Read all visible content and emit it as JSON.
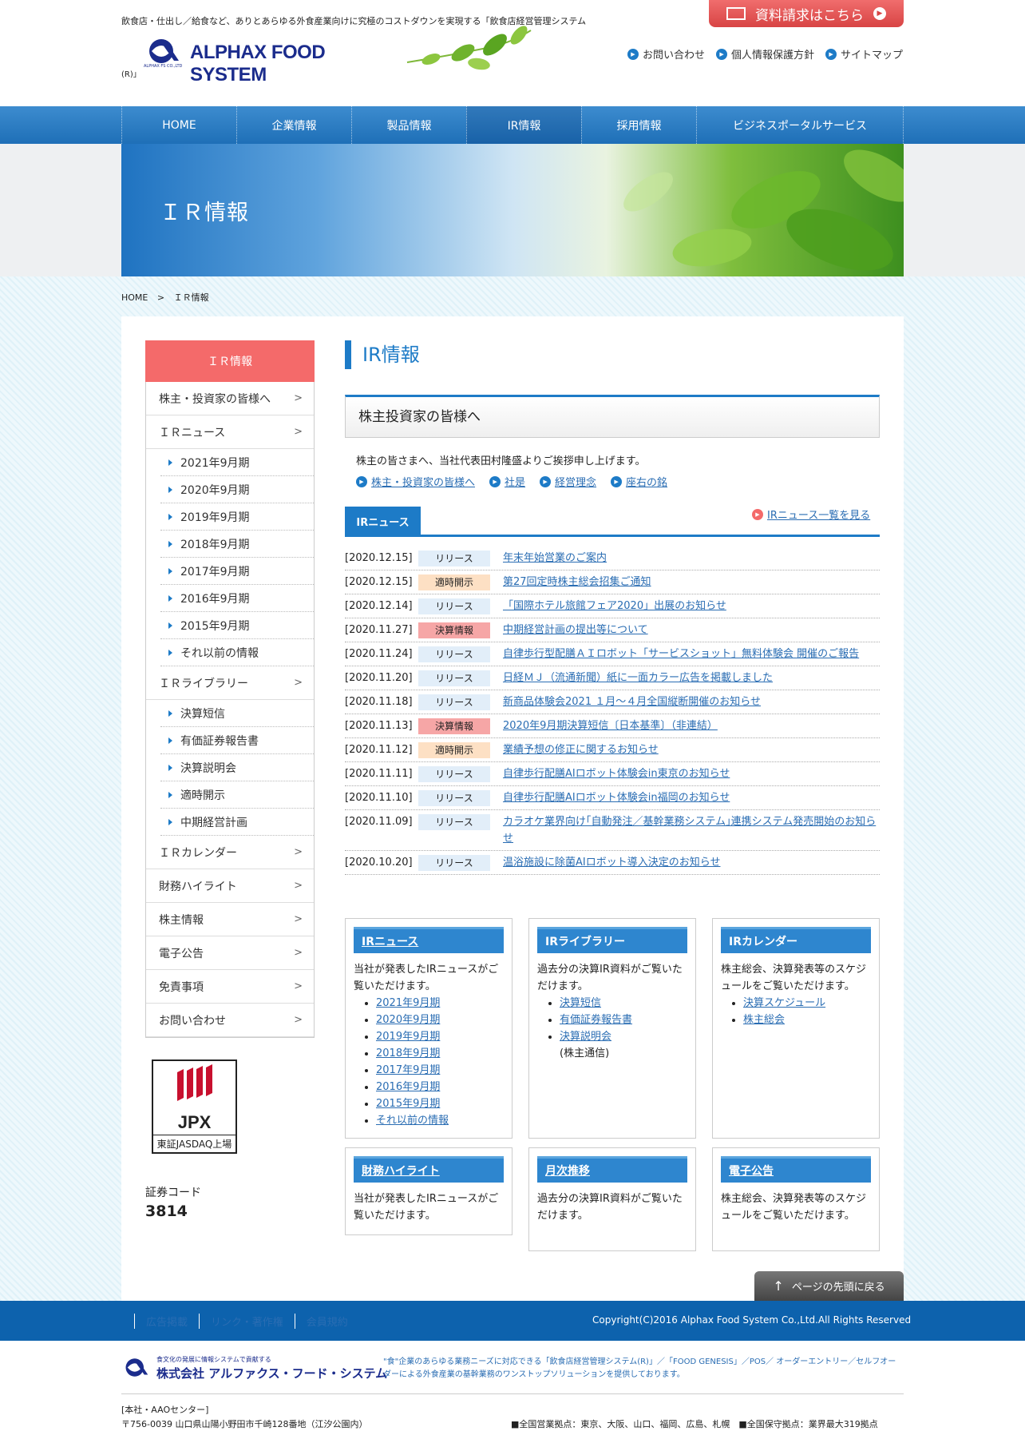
{
  "header": {
    "tagline": "飲食店・仕出し／給食など、ありとあらゆる外食産業向けに究極のコストダウンを実現する「飲食店経営管理システム",
    "tagline_end": "(R)」",
    "logo_text": "ALPHAX FOOD SYSTEM",
    "logo_sub": "ALPHAX FS CO.,LTD",
    "request_button": "資料請求はこちら",
    "links": [
      "お問い合わせ",
      "個人情報保護方針",
      "サイトマップ"
    ]
  },
  "nav": [
    "HOME",
    "企業情報",
    "製品情報",
    "IR情報",
    "採用情報",
    "ビジネスポータルサービス"
  ],
  "banner_title": "ＩＲ情報",
  "breadcrumb": {
    "home": "HOME",
    "sep": ">",
    "current": "ＩＲ情報"
  },
  "sidebar": {
    "title": "ＩＲ情報",
    "items": [
      {
        "label": "株主・投資家の皆様へ",
        "level": 1
      },
      {
        "label": "ＩＲニュース",
        "level": 1
      },
      {
        "label": "2021年9月期",
        "level": 2
      },
      {
        "label": "2020年9月期",
        "level": 2
      },
      {
        "label": "2019年9月期",
        "level": 2
      },
      {
        "label": "2018年9月期",
        "level": 2
      },
      {
        "label": "2017年9月期",
        "level": 2
      },
      {
        "label": "2016年9月期",
        "level": 2
      },
      {
        "label": "2015年9月期",
        "level": 2
      },
      {
        "label": "それ以前の情報",
        "level": 2
      },
      {
        "label": "ＩＲライブラリー",
        "level": 1
      },
      {
        "label": "決算短信",
        "level": 2
      },
      {
        "label": "有価証券報告書",
        "level": 2
      },
      {
        "label": "決算説明会",
        "level": 2
      },
      {
        "label": "適時開示",
        "level": 2
      },
      {
        "label": "中期経営計画",
        "level": 2
      },
      {
        "label": "ＩＲカレンダー",
        "level": 1
      },
      {
        "label": "財務ハイライト",
        "level": 1
      },
      {
        "label": "株主情報",
        "level": 1
      },
      {
        "label": "電子公告",
        "level": 1
      },
      {
        "label": "免責事項",
        "level": 1
      },
      {
        "label": "お問い合わせ",
        "level": 1
      }
    ],
    "jpx": "JPX",
    "jpx_sub": "東証JASDAQ上場",
    "code_label": "証券コード",
    "code_value": "3814"
  },
  "main": {
    "title": "IR情報",
    "greeting_title": "株主投資家の皆様へ",
    "greeting_text": "株主の皆さまへ、当社代表田村隆盛よりご挨拶申し上げます。",
    "greeting_links": [
      "株主・投資家の皆様へ",
      "社是",
      "経営理念",
      "座右の銘"
    ],
    "news_tab": "IRニュース",
    "news_all": "IRニュース一覧を見る",
    "news": [
      {
        "date": "[2020.12.15]",
        "tag": "リリース",
        "type": "rel",
        "title": "年末年始営業のご案内"
      },
      {
        "date": "[2020.12.15]",
        "tag": "適時開示",
        "type": "time",
        "title": "第27回定時株主総会招集ご通知"
      },
      {
        "date": "[2020.12.14]",
        "tag": "リリース",
        "type": "rel",
        "title": "「国際ホテル旅館フェア2020」出展のお知らせ"
      },
      {
        "date": "[2020.11.27]",
        "tag": "決算情報",
        "type": "fin",
        "title": "中期経営計画の提出等について"
      },
      {
        "date": "[2020.11.24]",
        "tag": "リリース",
        "type": "rel",
        "title": "自律歩行型配膳ＡＩロボット「サービスショット」無料体験会 開催のご報告"
      },
      {
        "date": "[2020.11.20]",
        "tag": "リリース",
        "type": "rel",
        "title": "日経ＭＪ（流通新聞）紙に一面カラー広告を掲載しました"
      },
      {
        "date": "[2020.11.18]",
        "tag": "リリース",
        "type": "rel",
        "title": "新商品体験会2021 １月～４月全国縦断開催のお知らせ"
      },
      {
        "date": "[2020.11.13]",
        "tag": "決算情報",
        "type": "fin",
        "title": "2020年9月期決算短信〔日本基準〕（非連結）"
      },
      {
        "date": "[2020.11.12]",
        "tag": "適時開示",
        "type": "time",
        "title": "業績予想の修正に関するお知らせ"
      },
      {
        "date": "[2020.11.11]",
        "tag": "リリース",
        "type": "rel",
        "title": "自律歩行配膳AIロボット体験会in東京のお知らせ"
      },
      {
        "date": "[2020.11.10]",
        "tag": "リリース",
        "type": "rel",
        "title": "自律歩行配膳AIロボット体験会in福岡のお知らせ"
      },
      {
        "date": "[2020.11.09]",
        "tag": "リリース",
        "type": "rel",
        "title": "カラオケ業界向け｢自動発注／基幹業務システム｣連携システム発売開始のお知らせ"
      },
      {
        "date": "[2020.10.20]",
        "tag": "リリース",
        "type": "rel",
        "title": "温浴施設に除菌AIロボット導入決定のお知らせ"
      }
    ],
    "boxes": [
      {
        "title": "IRニュース",
        "link": true,
        "text": "当社が発表したIRニュースがご覧いただけます。",
        "items": [
          "2021年9月期",
          "2020年9月期",
          "2019年9月期",
          "2018年9月期",
          "2017年9月期",
          "2016年9月期",
          "2015年9月期",
          "それ以前の情報"
        ]
      },
      {
        "title": "IRライブラリー",
        "link": false,
        "text": "過去分の決算IR資料がご覧いただけます。",
        "items": [
          "決算短信",
          "有価証券報告書",
          "決算説明会"
        ],
        "note": "(株主通信)"
      },
      {
        "title": "IRカレンダー",
        "link": false,
        "text": "株主総会、決算発表等のスケジュールをご覧いただけます。",
        "items": [
          "決算スケジュール",
          "株主総会"
        ]
      },
      {
        "title": "財務ハイライト",
        "link": true,
        "text": "当社が発表したIRニュースがご覧いただけます。",
        "items": []
      },
      {
        "title": "月次推移",
        "link": true,
        "text": "過去分の決算IR資料がご覧いただけます。",
        "items": []
      },
      {
        "title": "電子公告",
        "link": true,
        "text": "株主総会、決算発表等のスケジュールをご覧いただけます。",
        "items": []
      }
    ],
    "page_top": "ページの先頭に戻る"
  },
  "footer": {
    "links": [
      "広告掲載",
      "リンク・著作権",
      "会員規約"
    ],
    "copyright": "Copyright(C)2016 Alphax Food System Co.,Ltd.All Rights Reserved",
    "logo_catch": "食文化の発展に情報システムで貢献する",
    "logo_name": "株式会社 アルファクス・フード・システム",
    "desc": "\"食\"企業のあらゆる業務ニーズに対応できる「飲食店経営管理システム(R)」／「FOOD GENESIS」／POS／ オーダーエントリー／セルフオーダーによる外食産業の基幹業務のワンストップソリューションを提供しております。",
    "addr_title": "[本社・AAOセンター]",
    "addr": "〒756-0039 山口県山陽小野田市千崎128番地（江汐公園内）",
    "bases": "■全国営業拠点：東京、大阪、山口、福岡、広島、札幌　■全国保守拠点：業界最大319拠点"
  }
}
